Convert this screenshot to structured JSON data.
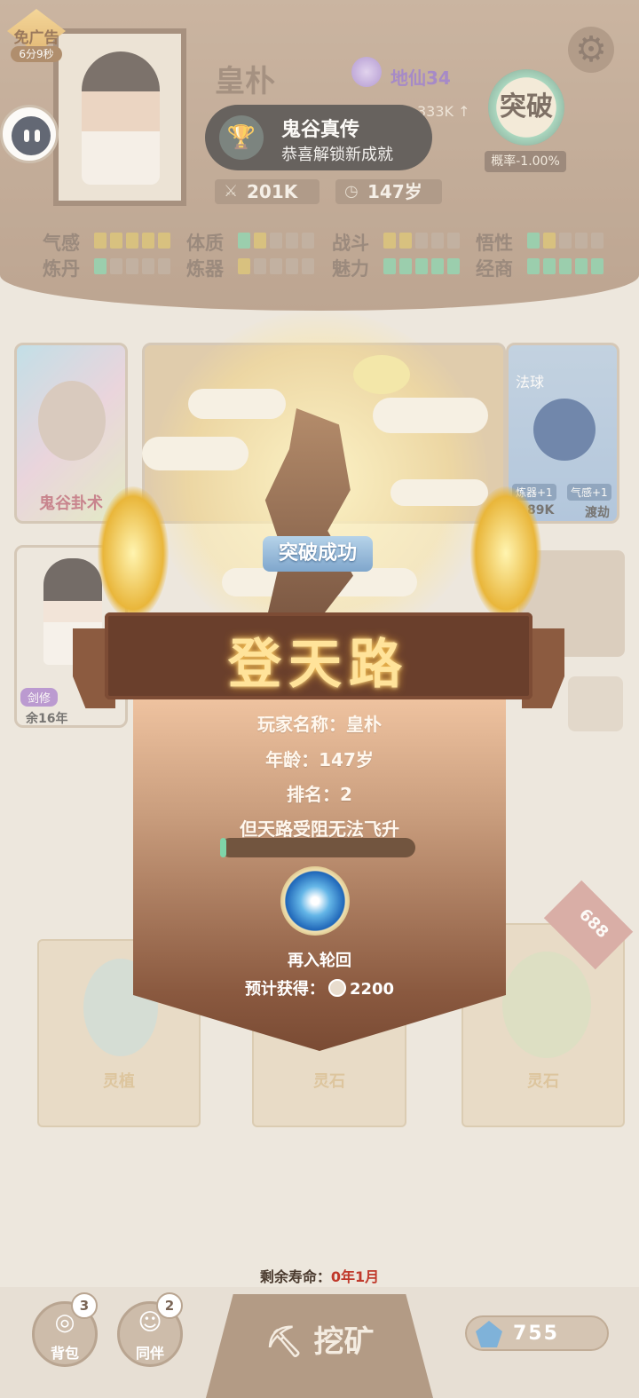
{
  "ad": {
    "label": "免广告",
    "timer": "6分9秒"
  },
  "player": {
    "name": "皇朴",
    "realm": "地仙34",
    "power": "201K",
    "age": "147岁",
    "exp_partial": "333K ↑"
  },
  "breakthrough": {
    "label": "突破",
    "probability": "概率-1.00%"
  },
  "toast": {
    "title": "鬼谷真传",
    "subtitle": "恭喜解锁新成就"
  },
  "attributes": [
    {
      "label": "气感",
      "level": 5,
      "of": 5,
      "color": "gold"
    },
    {
      "label": "体质",
      "level": 2,
      "of": 5,
      "color": "mixed-gold-green"
    },
    {
      "label": "战斗",
      "level": 2,
      "of": 5,
      "color": "gold"
    },
    {
      "label": "悟性",
      "level": 2,
      "of": 5,
      "color": "mixed-green-gold"
    },
    {
      "label": "炼丹",
      "level": 1,
      "of": 5,
      "color": "green"
    },
    {
      "label": "炼器",
      "level": 1,
      "of": 5,
      "color": "gold"
    },
    {
      "label": "魅力",
      "level": 5,
      "of": 5,
      "color": "green"
    },
    {
      "label": "经商",
      "level": 5,
      "of": 5,
      "color": "green"
    }
  ],
  "cards": {
    "first": "鬼谷卦术",
    "last_tag1": "炼器+1",
    "last_tag2": "气感+1",
    "last_power": "7.89K",
    "last_action": "渡劫",
    "spell_title": "法球",
    "spell_sub": "法球"
  },
  "companion_card": {
    "tag": "剑修",
    "years": "余16年"
  },
  "dialog": {
    "success": "突破成功",
    "title": "登天路",
    "player_line": "玩家名称：皇朴",
    "age_line": "年龄：147岁",
    "rank_line": "排名：2",
    "blocked_line": "但天路受阻无法飞升",
    "progress": 0.03,
    "reincarnate": "再入轮回",
    "reward_label": "预计获得：",
    "reward_value": "2200"
  },
  "packs": [
    {
      "label": "灵植"
    },
    {
      "label": "灵石"
    },
    {
      "label": "灵石",
      "badge": "688"
    }
  ],
  "lifespan": {
    "label": "剩余寿命：",
    "value": "0年1月"
  },
  "bottom": {
    "bag_label": "背包",
    "bag_count": "3",
    "partner_label": "同伴",
    "partner_count": "2",
    "mine_label": "挖矿",
    "spirit_stones": "755"
  }
}
